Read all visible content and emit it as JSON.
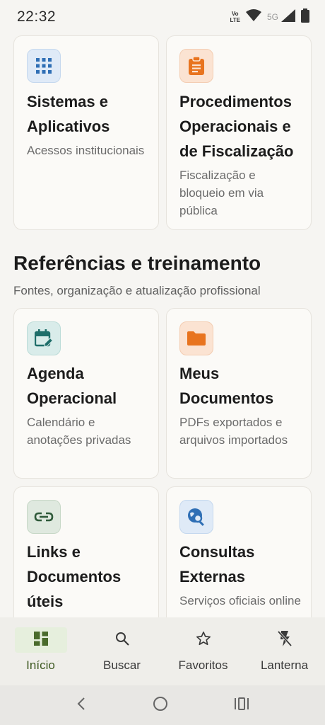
{
  "status": {
    "time": "22:32",
    "volte_top": "Vo",
    "volte_bottom": "LTE",
    "network": "5G"
  },
  "cards_top": [
    {
      "title": "Sistemas e Aplicativos",
      "desc": "Acessos institucionais",
      "icon": "grid-icon"
    },
    {
      "title": "Procedimentos Operacionais e de Fiscalização",
      "desc": "Fiscalização e bloqueio em via pública",
      "icon": "clipboard-icon"
    }
  ],
  "section": {
    "title": "Referências e treinamento",
    "subtitle": "Fontes, organização e atualização profissional"
  },
  "cards": [
    {
      "title": "Agenda Operacional",
      "desc": "Calendário e anotações privadas",
      "icon": "calendar-edit-icon"
    },
    {
      "title": "Meus Documentos",
      "desc": "PDFs exportados e arquivos importados",
      "icon": "folder-icon"
    },
    {
      "title": "Links e Documentos úteis",
      "desc": "",
      "icon": "link-icon"
    },
    {
      "title": "Consultas Externas",
      "desc": "Serviços oficiais online",
      "icon": "globe-search-icon"
    }
  ],
  "nav": {
    "inicio": "Início",
    "buscar": "Buscar",
    "favoritos": "Favoritos",
    "lanterna": "Lanterna"
  },
  "colors": {
    "accent_green": "#3f5a22",
    "blue_icon": "#2f6fb5",
    "orange_icon": "#e8741f",
    "teal_icon": "#1f6e6a",
    "green_icon": "#2f5a3a"
  }
}
